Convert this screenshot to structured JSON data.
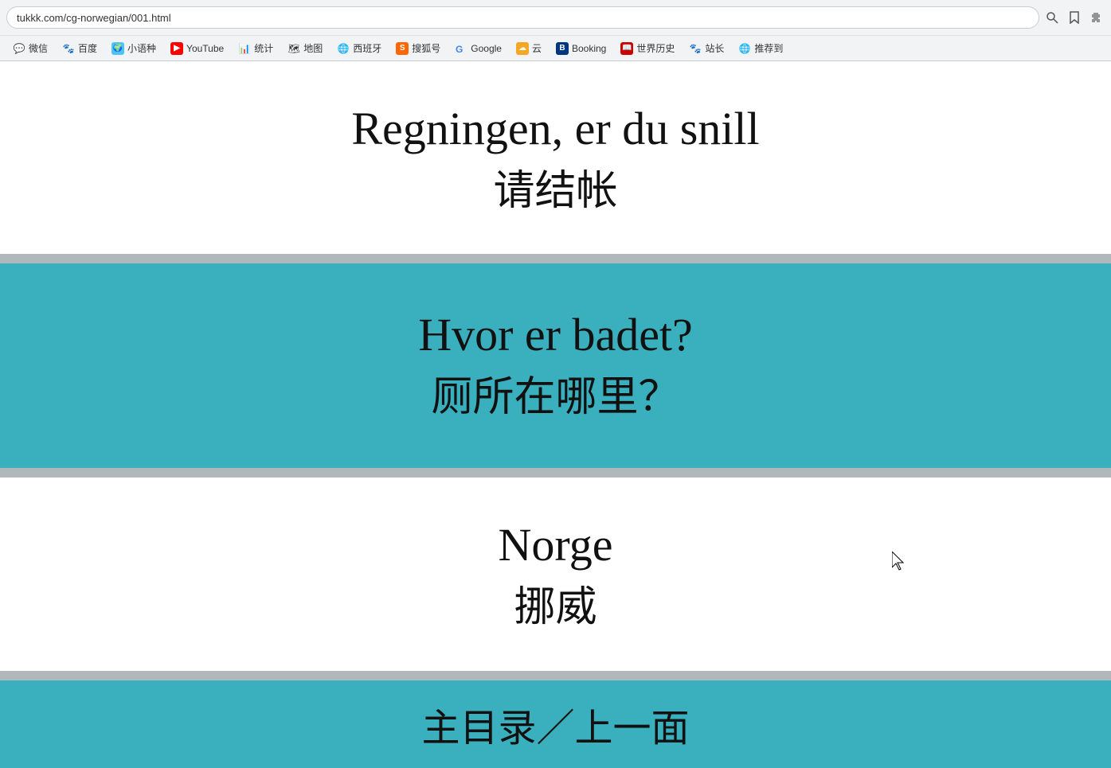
{
  "browser": {
    "address": "tukkk.com/cg-norwegian/001.html",
    "search_icon": "🔍",
    "bookmark_icon": "🔖",
    "extension_icon": "🧩"
  },
  "bookmarks": [
    {
      "id": "weixin",
      "label": "微信",
      "color": "#07C160",
      "icon": "💬"
    },
    {
      "id": "baidu",
      "label": "百度",
      "color": "#2932E1",
      "icon": "🐾"
    },
    {
      "id": "xiaoyuzhong",
      "label": "小语种",
      "color": "#ff6600",
      "icon": "🌐"
    },
    {
      "id": "youtube",
      "label": "YouTube",
      "color": "#FF0000",
      "icon": "▶"
    },
    {
      "id": "tongji",
      "label": "统计",
      "color": "#4a90d9",
      "icon": "📊"
    },
    {
      "id": "ditu",
      "label": "地图",
      "color": "#4285F4",
      "icon": "🗺"
    },
    {
      "id": "xibanya",
      "label": "西班牙",
      "color": "#e8a020",
      "icon": "🌐"
    },
    {
      "id": "souhu",
      "label": "搜狐号",
      "color": "#FF6600",
      "icon": "S"
    },
    {
      "id": "google",
      "label": "Google",
      "color": "#4285F4",
      "icon": "G"
    },
    {
      "id": "yun",
      "label": "云",
      "color": "#f5a623",
      "icon": "☁"
    },
    {
      "id": "booking",
      "label": "Booking",
      "color": "#003580",
      "icon": "B"
    },
    {
      "id": "shijieli",
      "label": "世界历史",
      "color": "#CC0000",
      "icon": "📖"
    },
    {
      "id": "zhangzhang",
      "label": "站长",
      "color": "#2932E1",
      "icon": "🐾"
    },
    {
      "id": "tuijian",
      "label": "推荐到",
      "color": "#4a90d9",
      "icon": "🌐"
    }
  ],
  "phrases": [
    {
      "id": "phrase1",
      "norwegian": "Regningen, er du snill",
      "chinese": "请结帐",
      "background": "white"
    },
    {
      "id": "phrase2",
      "norwegian": "Hvor er badet?",
      "chinese": "厕所在哪里？",
      "background": "teal"
    },
    {
      "id": "phrase3",
      "norwegian": "Norge",
      "chinese": "挪威",
      "background": "white"
    }
  ],
  "footer": {
    "text": "主目录／上一面"
  },
  "colors": {
    "teal": "#3aafbe",
    "divider": "#b0b8bc",
    "white": "#ffffff"
  }
}
